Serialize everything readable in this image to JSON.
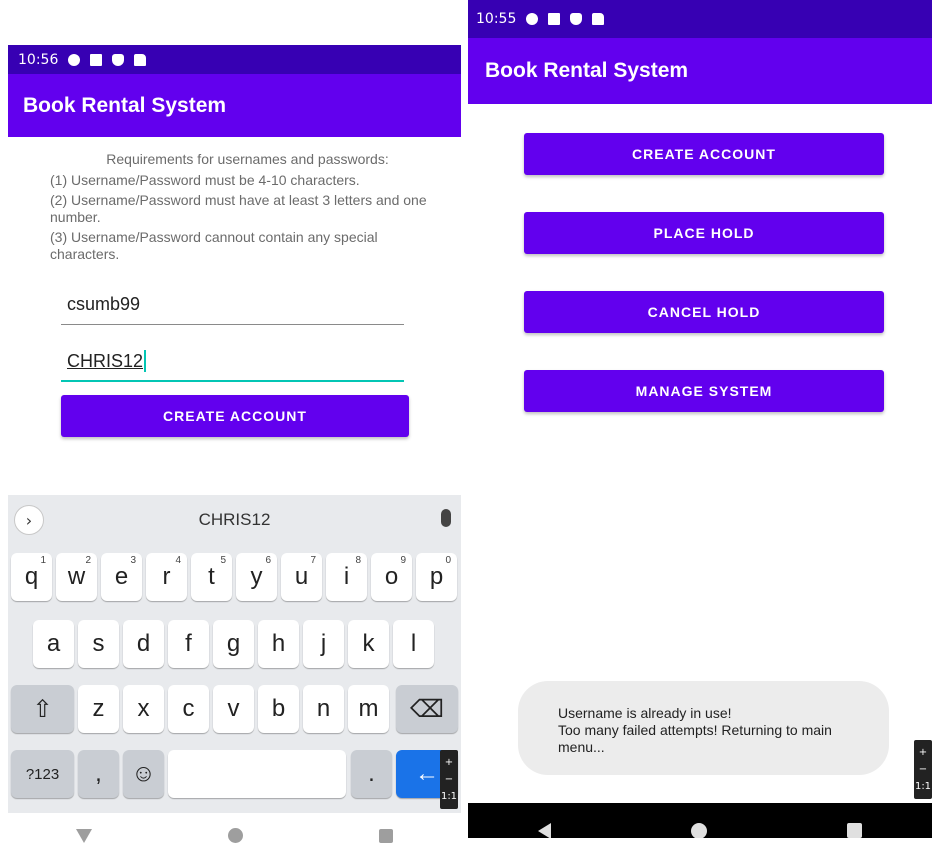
{
  "left": {
    "status": {
      "time": "10:56"
    },
    "app_title": "Book Rental System",
    "requirements": {
      "heading": "Requirements for usernames and passwords:",
      "line1": "(1) Username/Password must be 4-10 characters.",
      "line2": "(2) Username/Password must have at least 3 letters and one number.",
      "line3": "(3) Username/Password cannout contain any special characters."
    },
    "username_value": "csumb99",
    "password_value": "CHRIS12",
    "create_button": "CREATE ACCOUNT",
    "keyboard": {
      "suggestion": "CHRIS12",
      "row1": [
        {
          "k": "q",
          "h": "1"
        },
        {
          "k": "w",
          "h": "2"
        },
        {
          "k": "e",
          "h": "3"
        },
        {
          "k": "r",
          "h": "4"
        },
        {
          "k": "t",
          "h": "5"
        },
        {
          "k": "y",
          "h": "6"
        },
        {
          "k": "u",
          "h": "7"
        },
        {
          "k": "i",
          "h": "8"
        },
        {
          "k": "o",
          "h": "9"
        },
        {
          "k": "p",
          "h": "0"
        }
      ],
      "row2": [
        "a",
        "s",
        "d",
        "f",
        "g",
        "h",
        "j",
        "k",
        "l"
      ],
      "row3": [
        "z",
        "x",
        "c",
        "v",
        "b",
        "n",
        "m"
      ],
      "symbols_key": "?123",
      "comma_key": ",",
      "period_key": ".",
      "emoji_key": "☺",
      "shift_key": "⇧",
      "backspace_key": "⌫",
      "enter_key": "←"
    },
    "zoom": {
      "plus": "+",
      "minus": "−",
      "ratio": "1:1"
    }
  },
  "right": {
    "status": {
      "time": "10:55"
    },
    "app_title": "Book Rental System",
    "buttons": {
      "create": "CREATE ACCOUNT",
      "place": "PLACE HOLD",
      "cancel": "CANCEL HOLD",
      "manage": "MANAGE SYSTEM"
    },
    "toast": {
      "line1": "Username is already in use!",
      "line2": "Too many failed attempts! Returning to main menu..."
    },
    "zoom": {
      "plus": "+",
      "minus": "−",
      "ratio": "1:1"
    }
  },
  "colors": {
    "status_bar": "#3700b3",
    "primary": "#6200ee",
    "accent": "#03c6b4",
    "enter_key": "#1a73e8"
  }
}
